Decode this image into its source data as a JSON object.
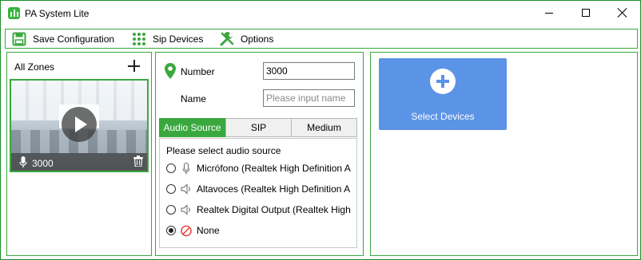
{
  "window": {
    "title": "PA System Lite",
    "accent": "#3aa83f"
  },
  "toolbar": {
    "save_label": "Save Configuration",
    "sip_label": "Sip Devices",
    "options_label": "Options"
  },
  "zones": {
    "header": "All Zones",
    "items": [
      {
        "number": "3000"
      }
    ]
  },
  "form": {
    "number_label": "Number",
    "number_value": "3000",
    "name_label": "Name",
    "name_placeholder": "Please input name"
  },
  "tabs": [
    "Audio Source",
    "SIP",
    "Medium"
  ],
  "audio_source": {
    "prompt": "Please select audio source",
    "options": [
      {
        "label": "Micrófono (Realtek High Definition A",
        "icon": "microphone-icon",
        "selected": false
      },
      {
        "label": "Altavoces (Realtek High Definition A",
        "icon": "speaker-icon",
        "selected": false
      },
      {
        "label": "Realtek Digital Output (Realtek High",
        "icon": "speaker-icon",
        "selected": false
      },
      {
        "label": "None",
        "icon": "none-icon",
        "selected": true
      }
    ]
  },
  "devices": {
    "select_label": "Select Devices",
    "button_color": "#5b93e6"
  }
}
